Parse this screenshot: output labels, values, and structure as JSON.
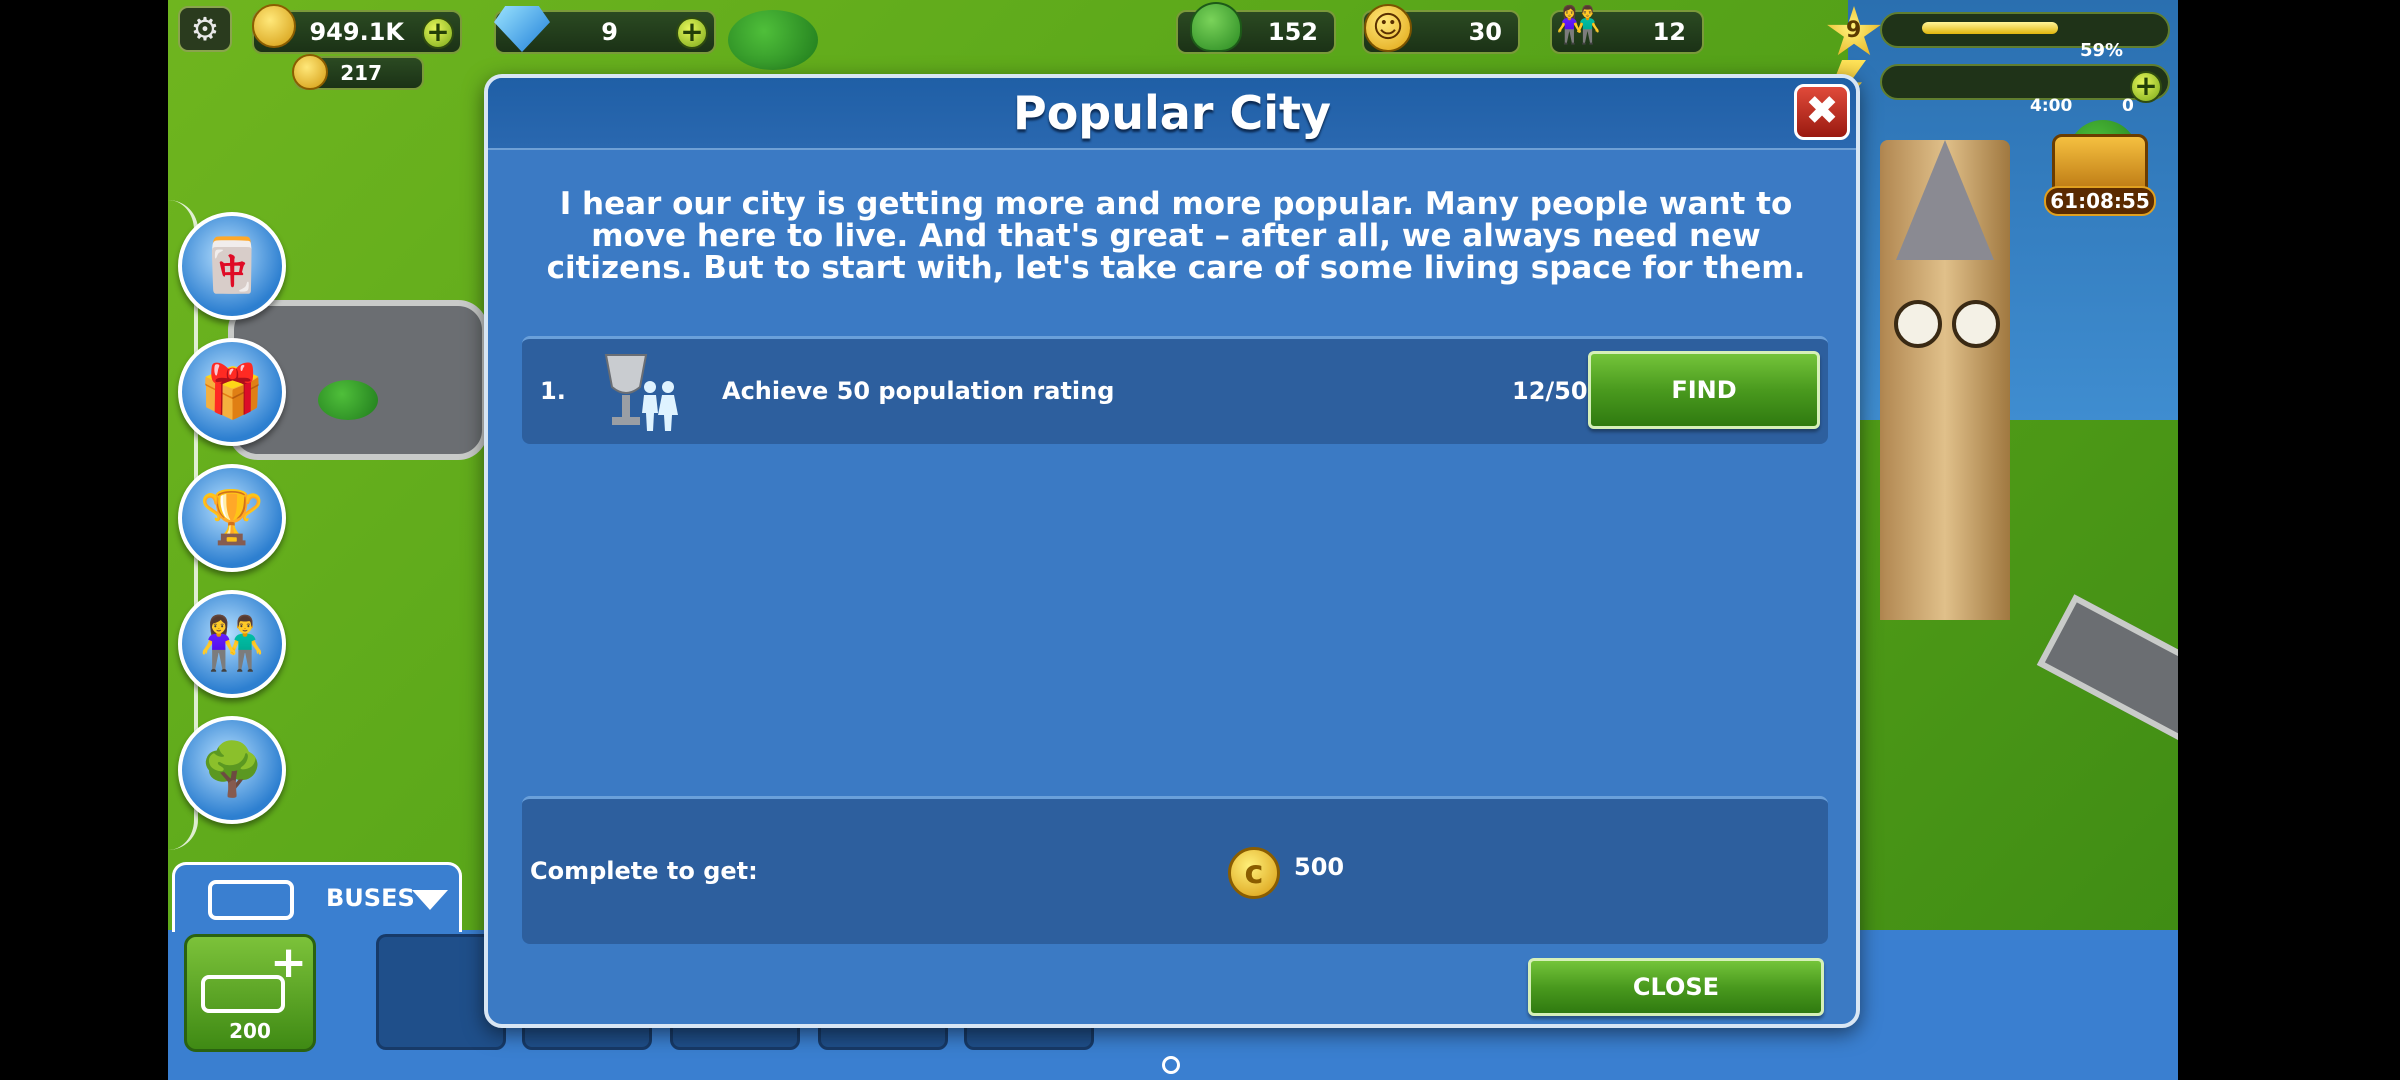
{
  "hud": {
    "coins": "949.1K",
    "sub_coins": "217",
    "gems": "9",
    "trees": "152",
    "happiness": "30",
    "population": "12",
    "level": "9",
    "level_progress_pct": 59,
    "level_progress_label": "59%",
    "energy_time": "4:00",
    "energy_value": "0",
    "chest_timer": "61:08:55"
  },
  "dialog": {
    "title": "Popular City",
    "intro": "I hear our city is getting more and more popular. Many people want to move here to live. And that's great – after all, we always need new citizens. But to start with, let's take care of some living space for them.",
    "tasks": [
      {
        "number": "1.",
        "label": "Achieve 50 population rating",
        "progress": "12/50",
        "button": "FIND"
      }
    ],
    "reward_label": "Complete to get:",
    "reward_value": "500",
    "close_button": "CLOSE"
  },
  "shop": {
    "category": "BUSES",
    "add_cost": "200"
  },
  "colors": {
    "dialog_bg": "#3b7ac4",
    "button_green": "#4a9a1e",
    "close_red": "#c0392b"
  }
}
